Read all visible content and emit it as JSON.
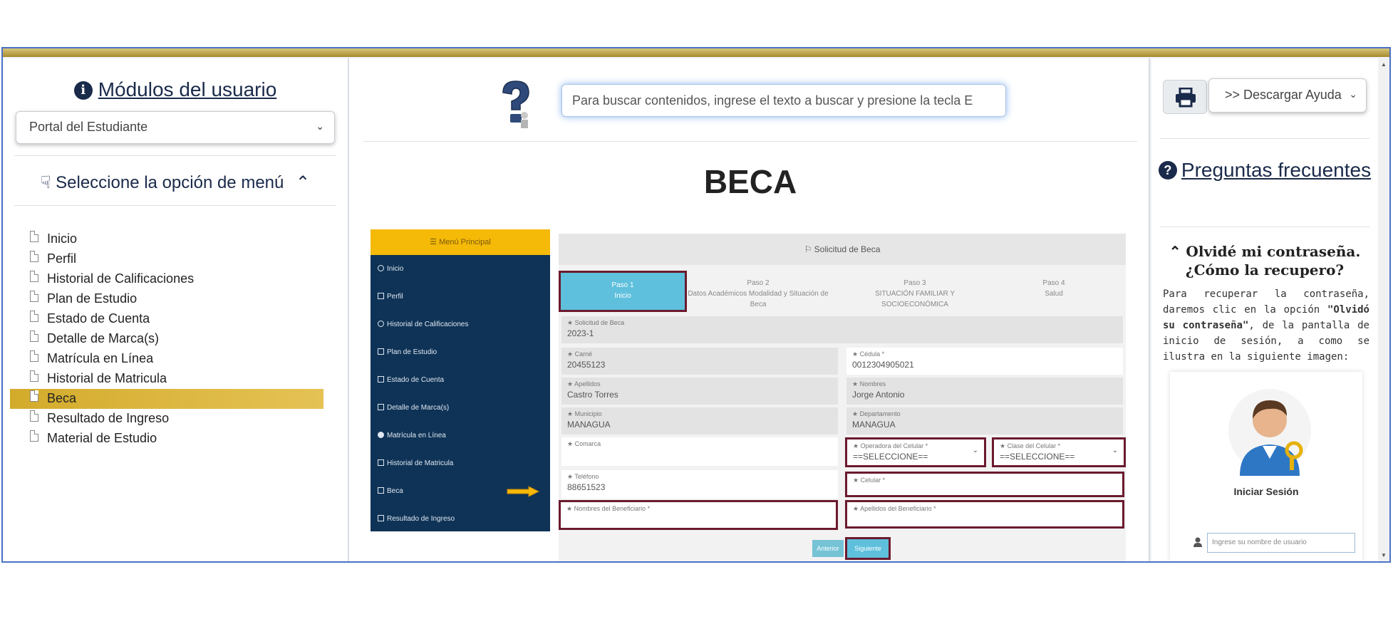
{
  "left": {
    "title": "Módulos del usuario",
    "portal_select": "Portal del Estudiante",
    "menu_heading": "Seleccione la opción de menú",
    "menu_items": [
      "Inicio",
      "Perfil",
      "Historial de Calificaciones",
      "Plan de Estudio",
      "Estado de Cuenta",
      "Detalle de Marca(s)",
      "Matrícula en Línea",
      "Historial de Matricula",
      "Beca",
      "Resultado de Ingreso",
      "Material de Estudio"
    ],
    "active_item": "Beca"
  },
  "middle": {
    "search_placeholder": "Para buscar contenidos, ingrese el texto a buscar y presione la tecla E",
    "page_title": "BECA",
    "shot": {
      "menu_head": "Menú Principal",
      "menu_items": [
        "Inicio",
        "Perfil",
        "Historial de Calificaciones",
        "Plan de Estudio",
        "Estado de Cuenta",
        "Detalle de Marca(s)",
        "Matrícula en Línea",
        "Historial de Matricula",
        "Beca",
        "Resultado de Ingreso"
      ],
      "panel_title": "Solicitud de Beca",
      "steps": [
        {
          "label": "Paso 1",
          "sub": "Inicio"
        },
        {
          "label": "Paso 2",
          "sub": "Datos Académicos Modalidad y Situación de Beca"
        },
        {
          "label": "Paso 3",
          "sub": "SITUACIÓN FAMILIAR Y SOCIOECONÓMICA"
        },
        {
          "label": "Paso 4",
          "sub": "Salud"
        }
      ],
      "fields": {
        "solicitud": {
          "label": "Solicitud de Beca",
          "value": "2023-1"
        },
        "carne": {
          "label": "Carné",
          "value": "20455123"
        },
        "cedula": {
          "label": "Cédula *",
          "value": "0012304905021"
        },
        "apellidos": {
          "label": "Apellidos",
          "value": "Castro Torres"
        },
        "nombres": {
          "label": "Nombres",
          "value": "Jorge Antonio"
        },
        "municipio": {
          "label": "Municipio",
          "value": "MANAGUA"
        },
        "departamento": {
          "label": "Departamento",
          "value": "MANAGUA"
        },
        "comarca": {
          "label": "Comarca",
          "value": ""
        },
        "operadora": {
          "label": "Operadora del Celular *",
          "value": "==SELECCIONE=="
        },
        "clase": {
          "label": "Clase del Celular *",
          "value": "==SELECCIONE=="
        },
        "telefono": {
          "label": "Teléfono",
          "value": "88651523"
        },
        "celular": {
          "label": "Celular *",
          "value": ""
        },
        "nombres_benef": {
          "label": "Nombres del Beneficiario *",
          "value": ""
        },
        "apellidos_benef": {
          "label": "Apellidos del Beneficiario *",
          "value": ""
        }
      },
      "btn_prev": "Anterior",
      "btn_next": "Siguiente"
    }
  },
  "right": {
    "download_select": ">> Descargar Ayuda",
    "faq_title": "Preguntas frecuentes",
    "forgot_title": "Olvidé mi contraseña. ¿Cómo la recupero?",
    "forgot_text_1": "Para recuperar la contraseña, daremos clic en la opción ",
    "forgot_text_bold": "\"Olvidó su contraseña\"",
    "forgot_text_2": ", de la pantalla de inicio de sesión, a como se ilustra en la siguiente imagen:",
    "login_label": "Iniciar Sesión",
    "username_placeholder": "Ingrese su nombre de usuario"
  },
  "colors": {
    "accent_gold": "#d3ab2b",
    "navy": "#1a2a4a",
    "step_active": "#5ec0dc",
    "highlight_border": "#6b1a2e"
  }
}
